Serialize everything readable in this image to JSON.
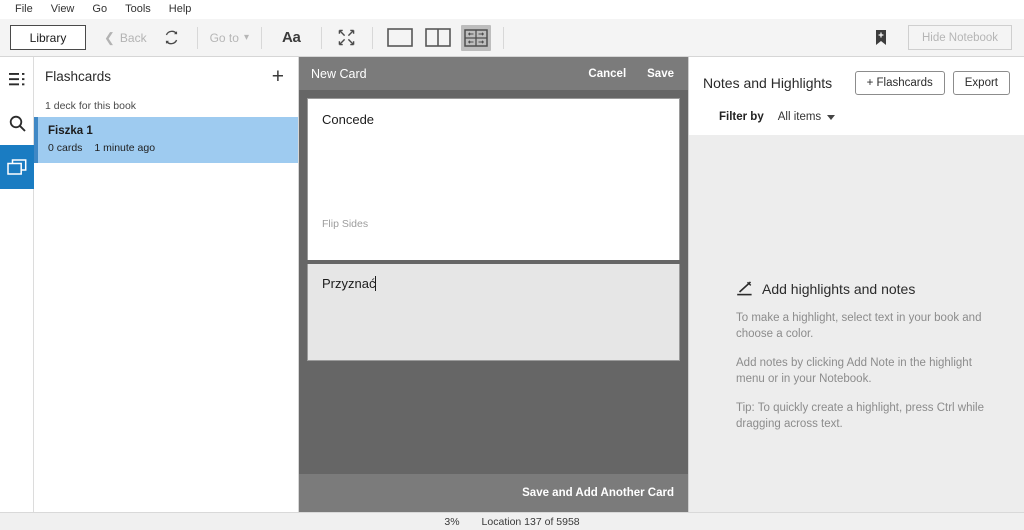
{
  "menubar": {
    "items": [
      {
        "label": "File"
      },
      {
        "label": "View"
      },
      {
        "label": "Go"
      },
      {
        "label": "Tools"
      },
      {
        "label": "Help"
      }
    ]
  },
  "toolbar": {
    "library_label": "Library",
    "back_label": "Back",
    "sync_icon": "refresh-icon",
    "goto_label": "Go to",
    "font_label": "Aa",
    "fullscreen_icon": "fullscreen-icon",
    "view_single_icon": "single-column-view-icon",
    "view_double_icon": "two-column-view-icon",
    "view_continuous_icon": "continuous-grid-view-icon",
    "bookmark_icon": "bookmark-icon",
    "hide_notebook_label": "Hide Notebook"
  },
  "rail": {
    "items": [
      {
        "name": "table-of-contents",
        "icon": "list-icon",
        "active": false
      },
      {
        "name": "search",
        "icon": "search-icon",
        "active": false
      },
      {
        "name": "flashcards",
        "icon": "flashcards-icon",
        "active": true
      }
    ]
  },
  "flashcards": {
    "title": "Flashcards",
    "add_label": "+",
    "subtitle": "1 deck for this book",
    "decks": [
      {
        "name": "Fiszka 1",
        "cards": "0 cards",
        "updated": "1 minute ago"
      }
    ]
  },
  "new_card": {
    "title": "New Card",
    "cancel_label": "Cancel",
    "save_label": "Save",
    "front_text": "Concede",
    "flip_label": "Flip Sides",
    "back_text": "Przyznać",
    "save_add_label": "Save and Add Another Card"
  },
  "notebook": {
    "title": "Notes and Highlights",
    "flashcards_btn": "+ Flashcards",
    "export_btn": "Export",
    "filter_label": "Filter by",
    "filter_value": "All items",
    "empty": {
      "heading": "Add highlights and notes",
      "heading_icon": "pencil-icon",
      "paragraphs": [
        "To make a highlight, select text in your book and choose a color.",
        "Add notes by clicking Add Note in the highlight menu or in your Notebook.",
        "Tip: To quickly create a highlight, press Ctrl while dragging across text."
      ]
    }
  },
  "statusbar": {
    "percent": "3%",
    "location": "Location 137 of 5958"
  },
  "colors": {
    "accent_blue": "#1a7cc2",
    "deck_selected": "#9ecbf0",
    "overlay": "#666666",
    "dialog_header": "#7b7b7b"
  }
}
